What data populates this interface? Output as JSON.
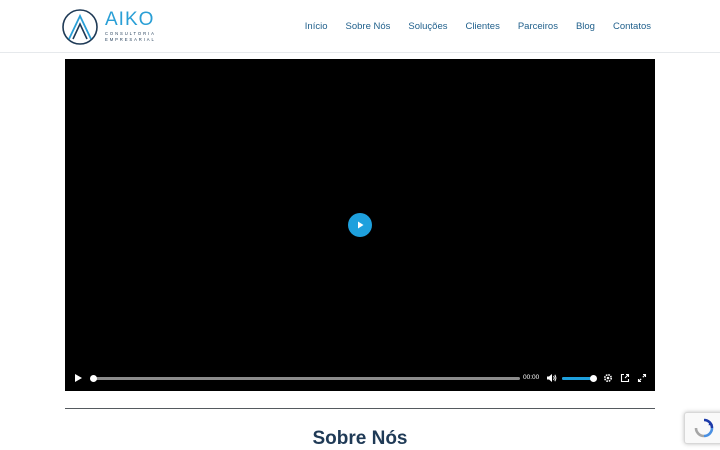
{
  "brand": {
    "name": "AIKO",
    "tagline_line1": "CONSULTORIA",
    "tagline_line2": "EMPRESARIAL",
    "primary_color": "#2a9fd6",
    "dark_color": "#1f3a56",
    "logo_icon": "triangle-circle-logo-icon"
  },
  "nav": {
    "items": [
      {
        "label": "Início"
      },
      {
        "label": "Sobre Nós"
      },
      {
        "label": "Soluções"
      },
      {
        "label": "Clientes"
      },
      {
        "label": "Parceiros"
      },
      {
        "label": "Blog"
      },
      {
        "label": "Contatos"
      }
    ]
  },
  "video_player": {
    "big_play_icon": "play-icon",
    "accent_color": "#1ea0dd",
    "current_time": "00:00",
    "progress": 0,
    "volume": 0.9,
    "controls": {
      "play": "play-icon",
      "mute": "volume-icon",
      "settings": "gear-icon",
      "pip": "picture-in-picture-icon",
      "fullscreen": "fullscreen-icon"
    }
  },
  "section": {
    "title": "Sobre Nós"
  },
  "recaptcha": {
    "icon": "recaptcha-icon"
  }
}
